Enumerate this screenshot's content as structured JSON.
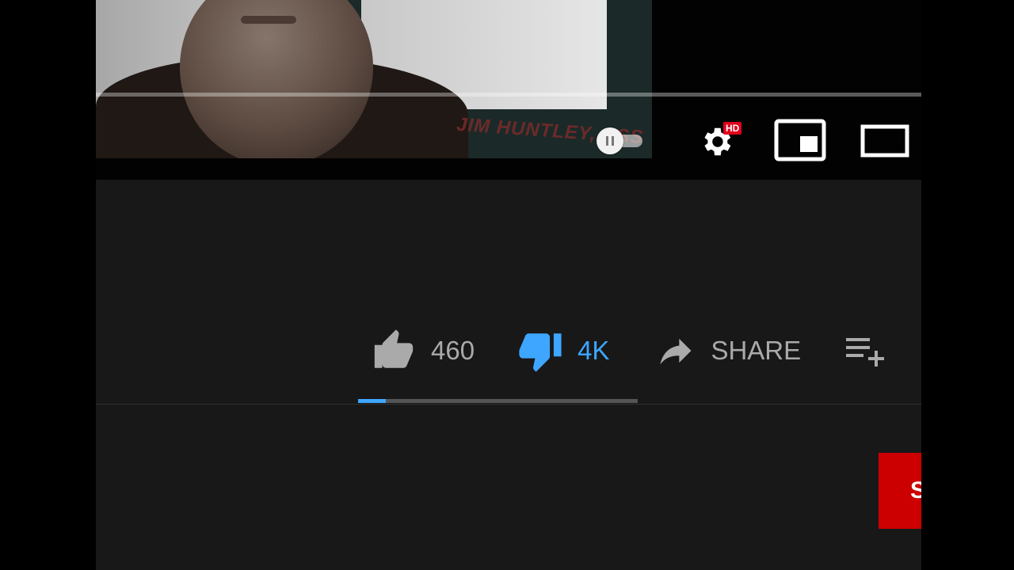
{
  "video": {
    "caption_text": "JIM HUNTLEY, USS",
    "progress": 0.0
  },
  "controls": {
    "autoplay_icon": "pause-icon",
    "settings_icon": "gear-icon",
    "quality_badge": "HD",
    "miniplayer_icon": "miniplayer-icon",
    "theater_icon": "theater-mode-icon"
  },
  "actions": {
    "like_count": "460",
    "dislike_count": "4K",
    "share_label": "SHARE",
    "save_icon": "add-to-playlist-icon"
  },
  "sentiment": {
    "like_fraction": 0.1
  },
  "subscribe_label": "S",
  "colors": {
    "accent": "#3ea6ff",
    "brand_red": "#cc0000",
    "hd_red": "#e3001b"
  }
}
